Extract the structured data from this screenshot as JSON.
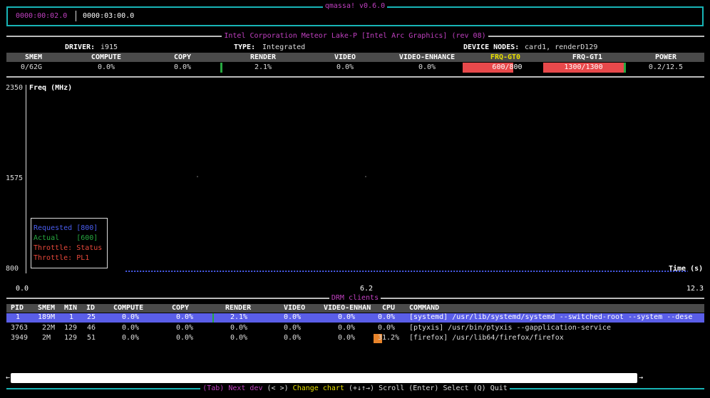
{
  "app": {
    "title": "qmassa! v0.6.0",
    "elapsed": "0000:00:02.0",
    "total": "0000:03:00.0"
  },
  "device": {
    "name": "Intel Corporation Meteor Lake-P [Intel Arc Graphics] (rev 08)",
    "driver_label": "DRIVER:",
    "driver": "i915",
    "type_label": "TYPE:",
    "type": "Integrated",
    "nodes_label": "DEVICE NODES:",
    "nodes": "card1, renderD129"
  },
  "metrics": {
    "headers": [
      "SMEM",
      "COMPUTE",
      "COPY",
      "RENDER",
      "VIDEO",
      "VIDEO-ENHANCE",
      "FRQ-GT0",
      "FRQ-GT1",
      "POWER"
    ],
    "values": [
      "0/62G",
      "0.0%",
      "0.0%",
      "2.1%",
      "0.0%",
      "0.0%",
      "600/800",
      "1300/1300",
      "0.2/12.5"
    ],
    "render_level": 0.021,
    "frq_gt0_level": 0.75,
    "frq_gt1_level": 1.0,
    "colors": {
      "active_header": "#e8e000",
      "bar": "#e8494b",
      "level": "#27a840"
    }
  },
  "chart": {
    "title": "Freq (MHz)",
    "y_ticks": [
      "2350",
      "1575",
      "800"
    ],
    "x_ticks": [
      "0.0",
      "6.2",
      "12.3"
    ],
    "x_label": "Time (s)",
    "legend": [
      {
        "label": "Requested [800]",
        "color": "#4a5ef0"
      },
      {
        "label": "Actual    [600]",
        "color": "#27a840"
      },
      {
        "label": "Throttle: Status",
        "color": "#e8493b"
      },
      {
        "label": "Throttle: PL1",
        "color": "#e8493b"
      }
    ]
  },
  "chart_data": {
    "type": "line",
    "ylim": [
      800,
      2350
    ],
    "xlim": [
      0.0,
      12.3
    ],
    "series": [
      {
        "name": "Requested [800]",
        "color": "#4a5ef0",
        "x": [
          1.8,
          12.0
        ],
        "y": [
          800,
          800
        ]
      }
    ]
  },
  "clients": {
    "section_title": "DRM clients",
    "headers": [
      "PID",
      "SMEM",
      "MIN",
      "ID",
      "COMPUTE",
      "COPY",
      "RENDER",
      "VIDEO",
      "VIDEO-ENHAN",
      "CPU",
      "COMMAND"
    ],
    "rows": [
      {
        "pid": "1",
        "smem": "189M",
        "min": "1",
        "id": "25",
        "compute": "0.0%",
        "copy": "0.0%",
        "render": "2.1%",
        "video": "0.0%",
        "venh": "0.0%",
        "cpu": "0.0%",
        "cmd": "[systemd] /usr/lib/systemd/systemd --switched-root --system --dese",
        "selected": true
      },
      {
        "pid": "3763",
        "smem": "22M",
        "min": "129",
        "id": "46",
        "compute": "0.0%",
        "copy": "0.0%",
        "render": "0.0%",
        "video": "0.0%",
        "venh": "0.0%",
        "cpu": "0.0%",
        "cmd": "[ptyxis] /usr/bin/ptyxis --gapplication-service",
        "selected": false
      },
      {
        "pid": "3949",
        "smem": "2M",
        "min": "129",
        "id": "51",
        "compute": "0.0%",
        "copy": "0.0%",
        "render": "0.0%",
        "video": "0.0%",
        "venh": "0.0%",
        "cpu": "31.2%",
        "cmd": "[firefox] /usr/lib64/firefox/firefox",
        "selected": false
      }
    ]
  },
  "footer": {
    "tab_key": "(Tab)",
    "tab_text": "Next dev",
    "chart_key": "(< >)",
    "chart_text": "Change chart",
    "scroll_key": "(+↓↑→)",
    "scroll_text": "Scroll",
    "select_key": "(Enter)",
    "select_text": "Select",
    "quit_key": "(Q)",
    "quit_text": "Quit"
  },
  "scroll": {
    "left": "←",
    "right": "→"
  }
}
